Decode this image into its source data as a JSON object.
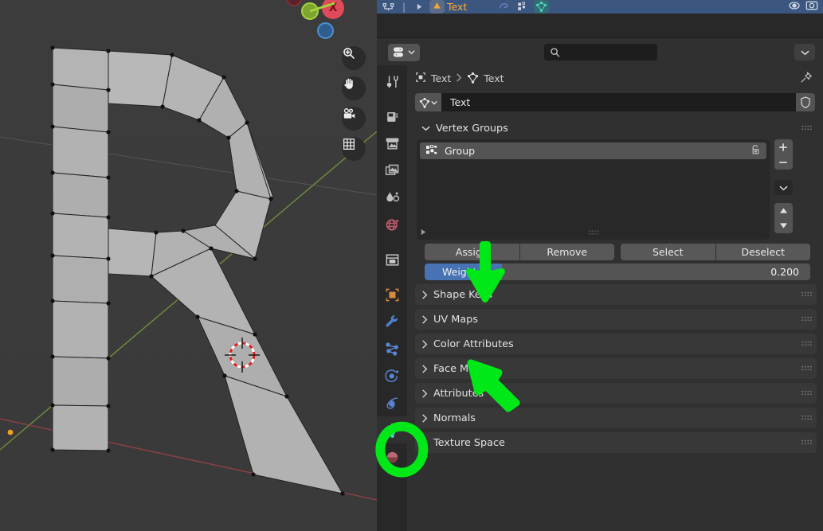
{
  "outliner": {
    "object_name": "Text",
    "icons": [
      "outliner-collection-icon",
      "disclosure-icon",
      "object-text-icon",
      "modifier-icon",
      "vertex-group-icon",
      "mesh-data-icon",
      "restrict-view-icon",
      "restrict-render-icon"
    ]
  },
  "properties": {
    "filter_label": "",
    "search": {
      "value": "",
      "placeholder": ""
    },
    "breadcrumb": [
      {
        "icon": "object-icon",
        "label": "Text"
      },
      {
        "icon": "mesh-data-icon",
        "label": "Text"
      }
    ],
    "id_block": {
      "icon": "mesh-data-icon",
      "name": "Text",
      "shield": "fake-user-icon"
    },
    "tabs": [
      {
        "name": "tool",
        "icon": "tool-icon",
        "active": false
      },
      {
        "name": "render",
        "icon": "render-icon",
        "active": false
      },
      {
        "name": "output",
        "icon": "output-icon",
        "active": false
      },
      {
        "name": "view-layer",
        "icon": "view-layer-icon",
        "active": false
      },
      {
        "name": "scene",
        "icon": "scene-icon",
        "active": false
      },
      {
        "name": "world",
        "icon": "world-icon",
        "active": false
      },
      {
        "name": "collection",
        "icon": "collection-icon",
        "active": false
      },
      {
        "name": "object",
        "icon": "object-icon",
        "active": false
      },
      {
        "name": "modifiers",
        "icon": "wrench-icon",
        "active": false
      },
      {
        "name": "particles",
        "icon": "particles-icon",
        "active": false
      },
      {
        "name": "physics",
        "icon": "physics-icon",
        "active": false
      },
      {
        "name": "constraints",
        "icon": "constraints-icon",
        "active": false
      },
      {
        "name": "data",
        "icon": "mesh-data-icon",
        "active": true
      },
      {
        "name": "material",
        "icon": "material-icon",
        "active": false
      }
    ],
    "vertex_groups": {
      "title": "Vertex Groups",
      "items": [
        {
          "name": "Group",
          "icon": "group-icon",
          "lock": "unlocked-icon",
          "selected": true
        }
      ],
      "side_buttons": [
        "add-icon",
        "remove-icon",
        "specials-chevron-icon",
        "move-up-icon",
        "move-down-icon"
      ],
      "operators": [
        "Assign",
        "Remove",
        "Select",
        "Deselect"
      ],
      "weight": {
        "label": "Weight",
        "value": "0.200",
        "percent": 20
      }
    },
    "collapsed_panels": [
      "Shape Keys",
      "UV Maps",
      "Color Attributes",
      "Face Maps",
      "Attributes",
      "Normals",
      "Texture Space"
    ]
  },
  "viewport": {
    "nav_buttons": [
      "zoom-icon",
      "hand-pan-icon",
      "camera-icon",
      "grid-ortho-icon"
    ],
    "gizmo_axes": [
      {
        "axis": "X",
        "color": "#e04a5a",
        "label": "X"
      },
      {
        "axis": "Y",
        "color": "#8fbf3f",
        "label": ""
      },
      {
        "axis": "Z",
        "color": "#3b7fc4",
        "label": ""
      }
    ],
    "object": "R",
    "cursor": "3d-cursor-icon"
  },
  "annotations": {
    "color": "#00e818",
    "arrows": [
      {
        "name": "arrow-to-assign",
        "target": "Assign"
      },
      {
        "name": "arrow-to-mesh-data-tab",
        "target": "Shape Keys"
      }
    ],
    "circles": [
      {
        "name": "circle-mesh-data-tab",
        "target": "mesh-data-tab"
      }
    ]
  }
}
